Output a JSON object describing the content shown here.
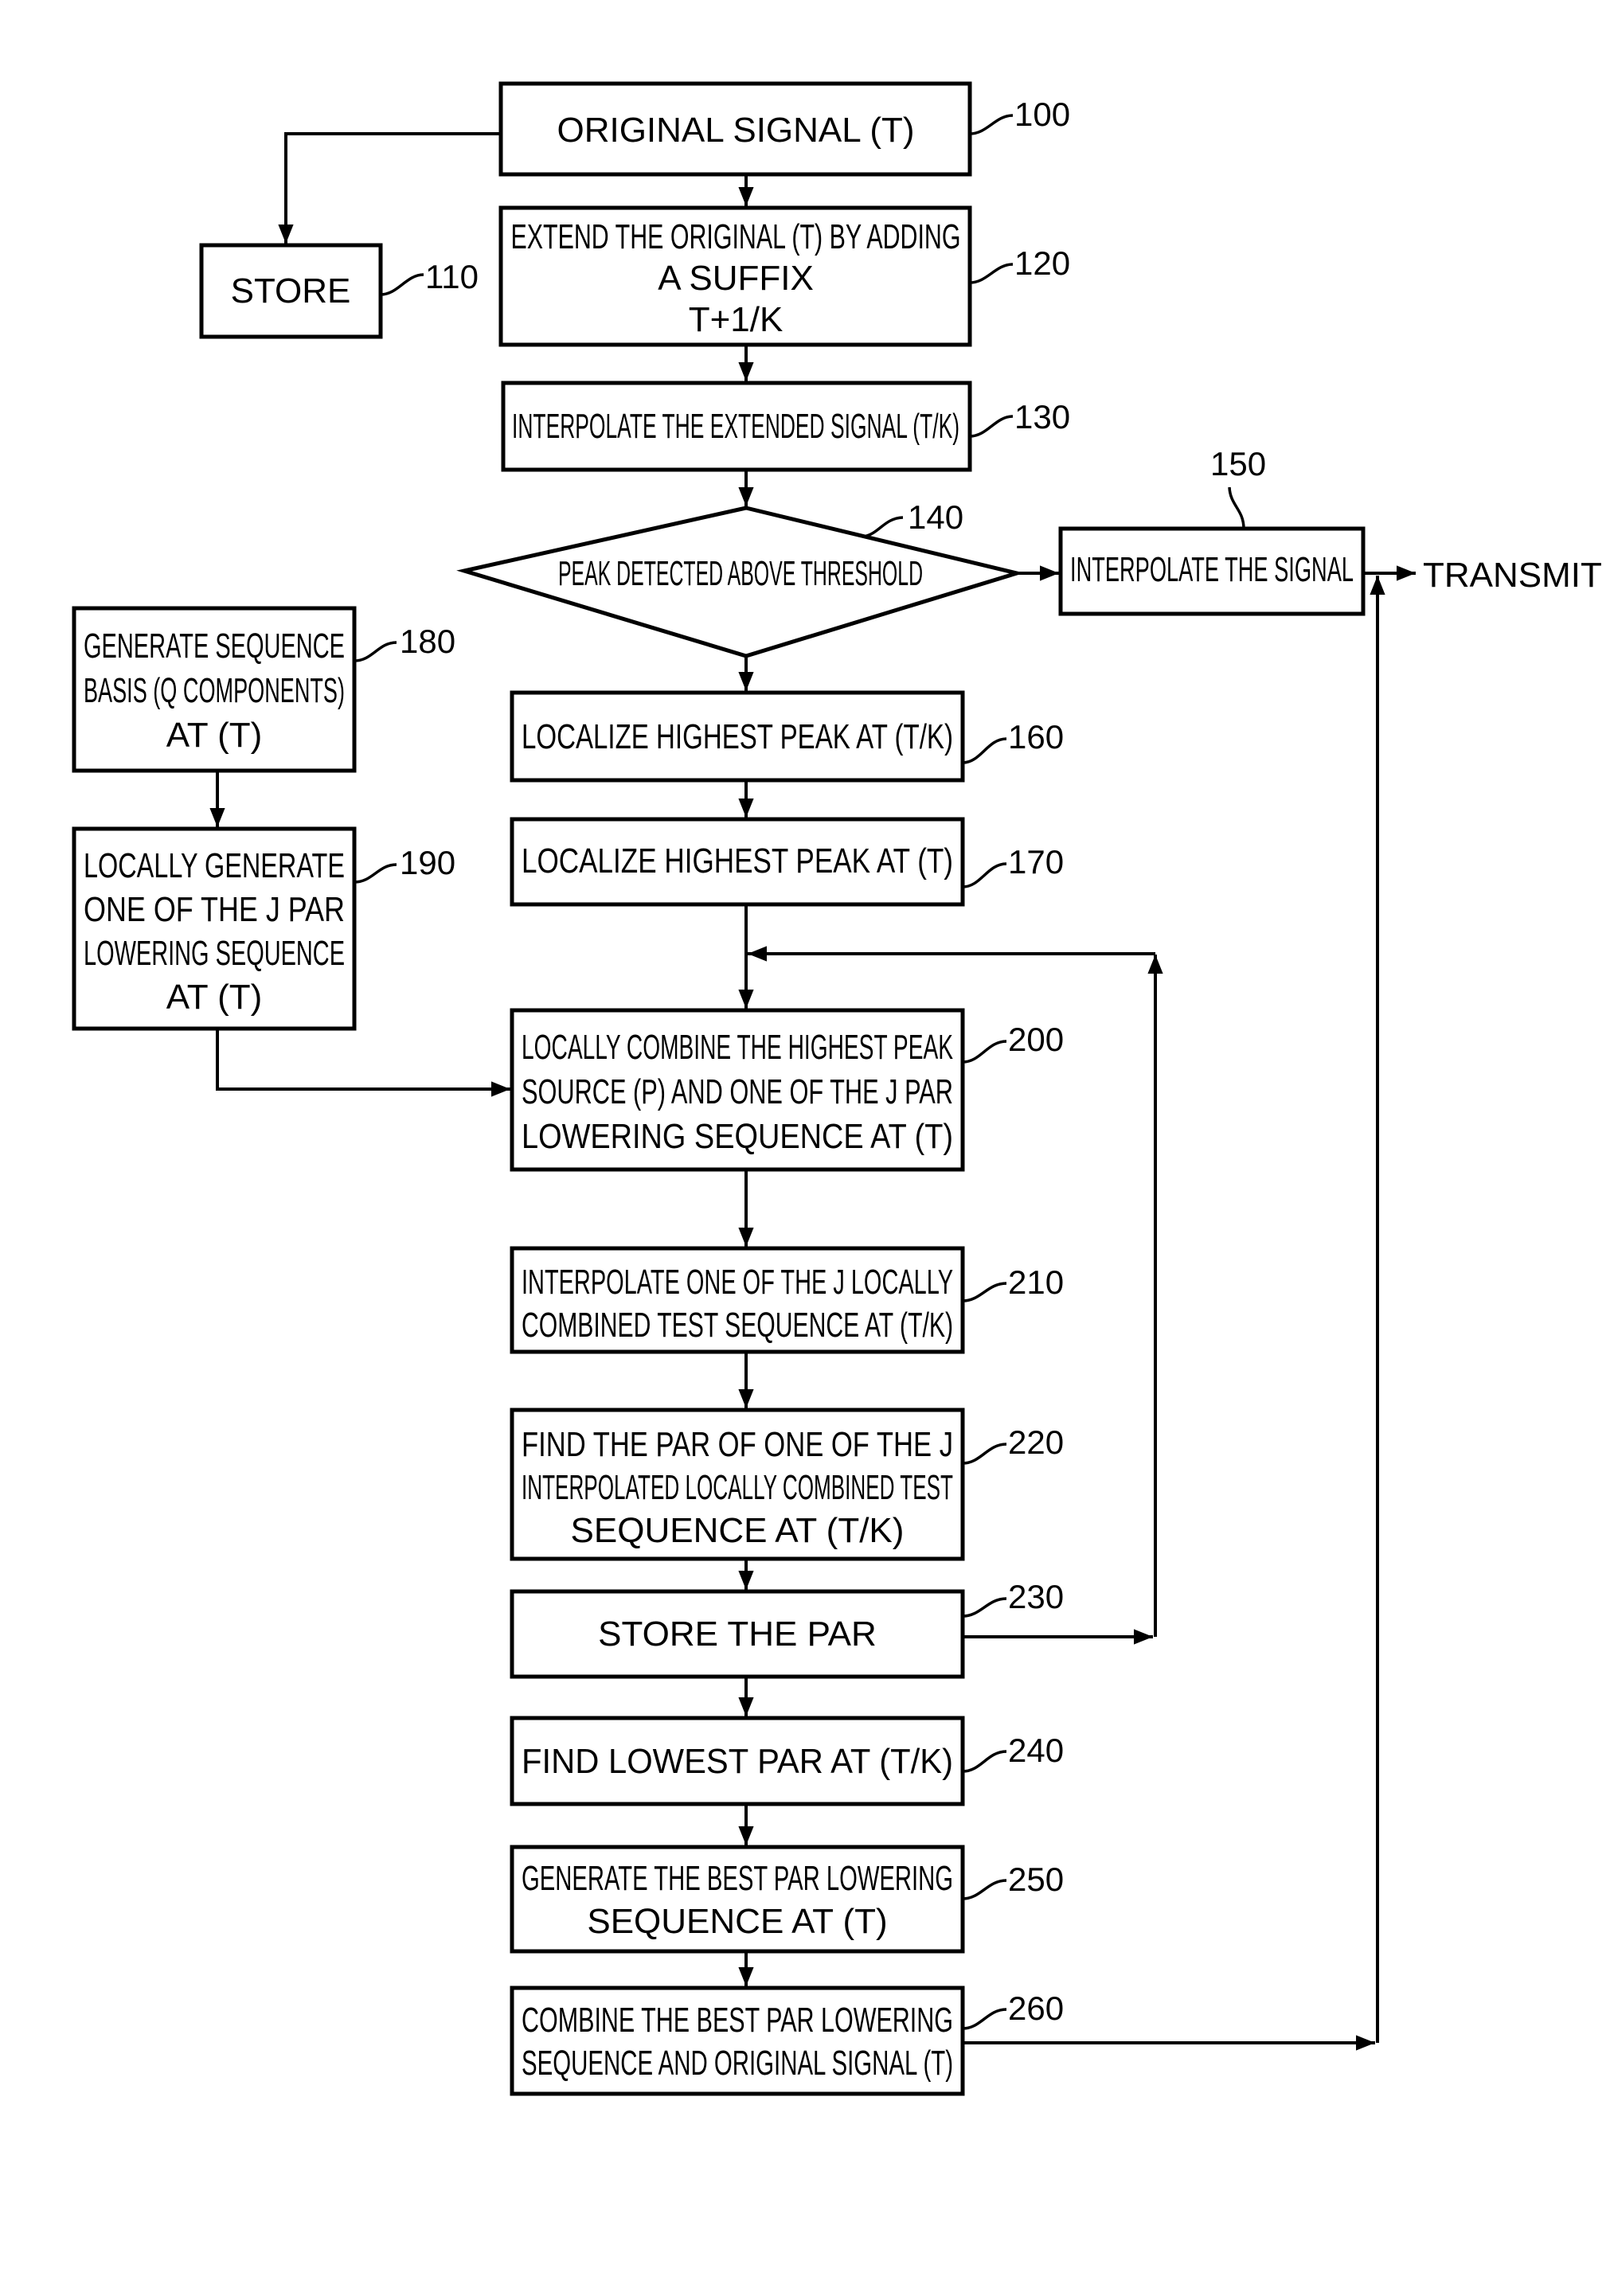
{
  "diagram": {
    "blocks": [
      {
        "id": "100",
        "shape": "rect",
        "lines": [
          "ORIGINAL SIGNAL (T)"
        ]
      },
      {
        "id": "110",
        "shape": "rect",
        "lines": [
          "STORE"
        ]
      },
      {
        "id": "120",
        "shape": "rect",
        "lines": [
          "EXTEND THE ORIGINAL (T) BY ADDING",
          "A SUFFIX",
          "T+1/K"
        ]
      },
      {
        "id": "130",
        "shape": "rect",
        "lines": [
          "INTERPOLATE THE EXTENDED SIGNAL (T/K)"
        ]
      },
      {
        "id": "140",
        "shape": "diamond",
        "lines": [
          "PEAK DETECTED ABOVE THRESHOLD"
        ]
      },
      {
        "id": "150",
        "shape": "rect",
        "lines": [
          "INTERPOLATE THE SIGNAL"
        ]
      },
      {
        "id": "160",
        "shape": "rect",
        "lines": [
          "LOCALIZE HIGHEST PEAK AT (T/K)"
        ]
      },
      {
        "id": "170",
        "shape": "rect",
        "lines": [
          "LOCALIZE HIGHEST PEAK AT (T)"
        ]
      },
      {
        "id": "180",
        "shape": "rect",
        "lines": [
          "GENERATE SEQUENCE",
          "BASIS (Q COMPONENTS)",
          "AT (T)"
        ]
      },
      {
        "id": "190",
        "shape": "rect",
        "lines": [
          "LOCALLY GENERATE",
          "ONE OF THE J PAR",
          "LOWERING SEQUENCE",
          "AT (T)"
        ]
      },
      {
        "id": "200",
        "shape": "rect",
        "lines": [
          "LOCALLY COMBINE THE HIGHEST PEAK",
          "SOURCE (P) AND ONE OF THE J PAR",
          "LOWERING SEQUENCE AT (T)"
        ]
      },
      {
        "id": "210",
        "shape": "rect",
        "lines": [
          "INTERPOLATE ONE OF THE J LOCALLY",
          "COMBINED TEST SEQUENCE AT (T/K)"
        ]
      },
      {
        "id": "220",
        "shape": "rect",
        "lines": [
          "FIND THE PAR OF ONE OF THE J",
          "INTERPOLATED LOCALLY COMBINED TEST",
          "SEQUENCE AT (T/K)"
        ]
      },
      {
        "id": "230",
        "shape": "rect",
        "lines": [
          "STORE THE PAR"
        ]
      },
      {
        "id": "240",
        "shape": "rect",
        "lines": [
          "FIND LOWEST PAR AT (T/K)"
        ]
      },
      {
        "id": "250",
        "shape": "rect",
        "lines": [
          "GENERATE THE BEST PAR LOWERING",
          "SEQUENCE AT (T)"
        ]
      },
      {
        "id": "260",
        "shape": "rect",
        "lines": [
          "COMBINE THE BEST PAR LOWERING",
          "SEQUENCE AND ORIGINAL SIGNAL (T)"
        ]
      }
    ],
    "output_label": "TRANSMIT",
    "edges": [
      [
        "100",
        "110"
      ],
      [
        "100",
        "120"
      ],
      [
        "120",
        "130"
      ],
      [
        "130",
        "140"
      ],
      [
        "140",
        "150"
      ],
      [
        "140",
        "160"
      ],
      [
        "160",
        "170"
      ],
      [
        "170",
        "200"
      ],
      [
        "180",
        "190"
      ],
      [
        "190",
        "200"
      ],
      [
        "200",
        "210"
      ],
      [
        "210",
        "220"
      ],
      [
        "220",
        "230"
      ],
      [
        "230",
        "200"
      ],
      [
        "230",
        "240"
      ],
      [
        "240",
        "250"
      ],
      [
        "250",
        "260"
      ],
      [
        "260",
        "150-output"
      ],
      [
        "150",
        "TRANSMIT"
      ]
    ]
  }
}
